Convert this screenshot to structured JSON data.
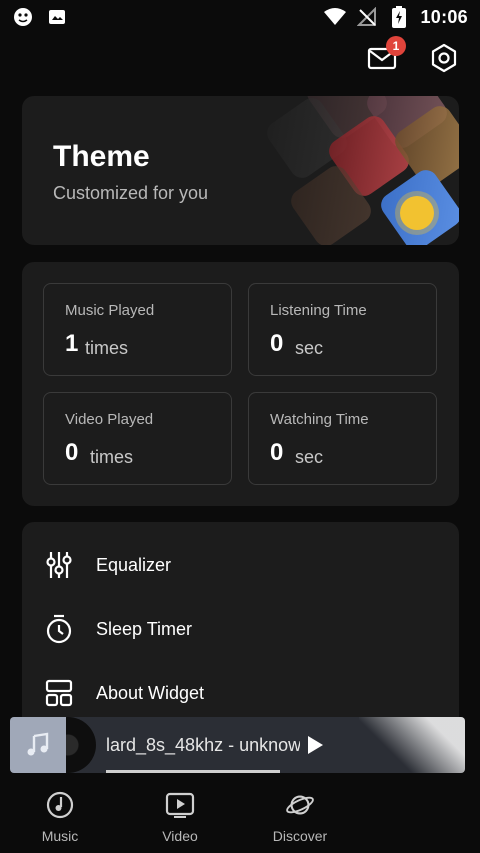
{
  "status_bar": {
    "time": "10:06",
    "icons": [
      "app-notification-icon",
      "photo-notification-icon",
      "wifi-icon",
      "no-signal-icon",
      "battery-charging-icon"
    ]
  },
  "header": {
    "mail_badge": "1",
    "icons": [
      "mail-icon",
      "settings-hexagon-icon"
    ]
  },
  "theme_card": {
    "title": "Theme",
    "subtitle": "Customized for you"
  },
  "stats": [
    {
      "label": "Music Played",
      "value": "1",
      "unit": "times"
    },
    {
      "label": "Listening Time",
      "value": "0",
      "unit": "sec"
    },
    {
      "label": "Video Played",
      "value": "0",
      "unit": "times"
    },
    {
      "label": "Watching Time",
      "value": "0",
      "unit": "sec"
    }
  ],
  "tools": [
    {
      "label": "Equalizer",
      "icon": "equalizer-icon"
    },
    {
      "label": "Sleep Timer",
      "icon": "timer-icon"
    },
    {
      "label": "About Widget",
      "icon": "widget-icon"
    }
  ],
  "mini_player": {
    "title": "lard_8s_48khz - unknow",
    "progress": 0.6
  },
  "bottom_nav": [
    {
      "label": "Music",
      "icon": "music-disc-icon"
    },
    {
      "label": "Video",
      "icon": "video-play-icon"
    },
    {
      "label": "Discover",
      "icon": "planet-icon"
    }
  ],
  "colors": {
    "background": "#0b0b0b",
    "card": "#1c1c1c",
    "badge": "#e0443b",
    "accent_tile": "#5b8fe3"
  }
}
